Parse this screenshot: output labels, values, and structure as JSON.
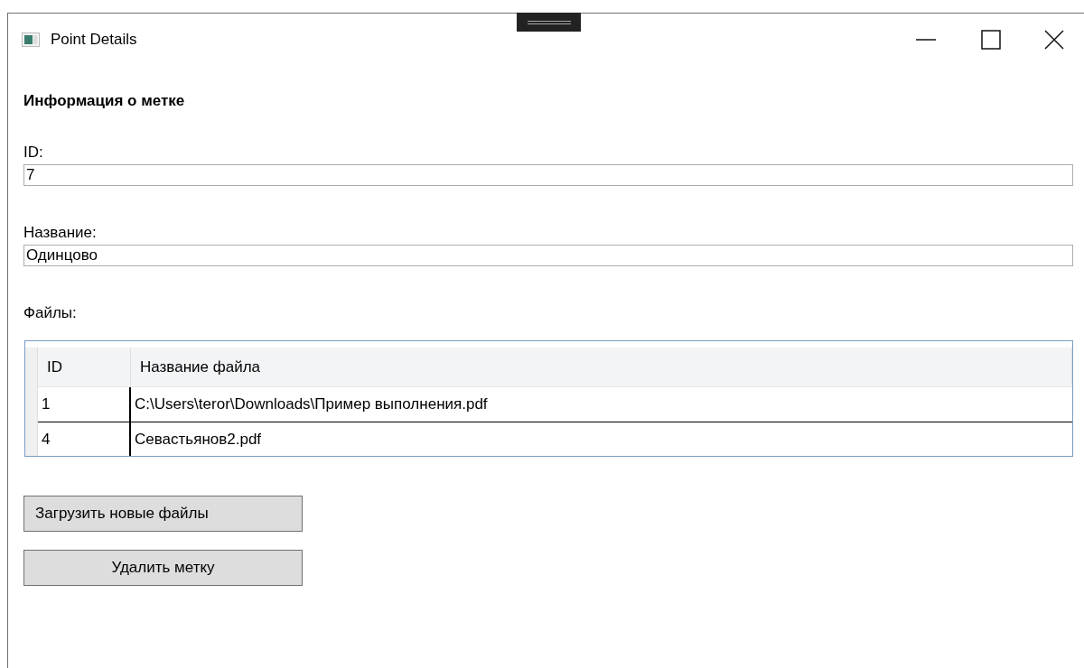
{
  "window": {
    "title": "Point Details"
  },
  "heading": "Информация о метке",
  "fields": [
    {
      "label": "ID:",
      "value": "7"
    },
    {
      "label": "Название:",
      "value": "Одинцово"
    }
  ],
  "files": {
    "label": "Файлы:",
    "columns": [
      "ID",
      "Название файла"
    ],
    "rows": [
      [
        "1",
        "C:\\Users\\teror\\Downloads\\Пример выполнения.pdf"
      ],
      [
        "4",
        "Севастьянов2.pdf"
      ]
    ]
  },
  "buttons": [
    "Загрузить новые файлы",
    "Удалить метку"
  ]
}
